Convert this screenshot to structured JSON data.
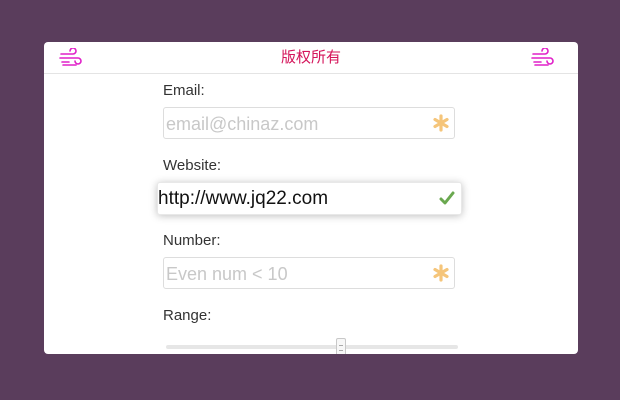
{
  "header": {
    "title": "版权所有",
    "left_icon": "wind-icon",
    "right_icon": "wind-icon",
    "accent_color": "#d4145a",
    "icon_color": "#e020c8"
  },
  "form": {
    "email": {
      "label": "Email:",
      "value": "",
      "placeholder": "email@chinaz.com",
      "status_icon": "asterisk-icon",
      "status_color": "#f5c57a"
    },
    "website": {
      "label": "Website:",
      "value": "http://www.jq22.com",
      "placeholder": "",
      "status_icon": "check-icon",
      "status_color": "#6aa84f"
    },
    "number": {
      "label": "Number:",
      "value": "",
      "placeholder": "Even num < 10",
      "status_icon": "asterisk-icon",
      "status_color": "#f5c57a"
    },
    "range": {
      "label": "Range:",
      "value_fraction": 0.6
    }
  },
  "colors": {
    "page_background": "#5a3d5c",
    "card_background": "#ffffff"
  }
}
